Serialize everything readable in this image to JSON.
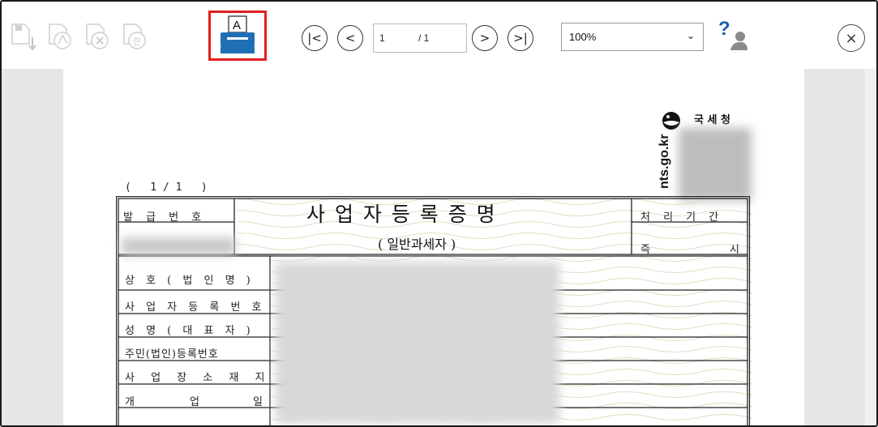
{
  "toolbar": {
    "page_current": "1",
    "page_total": "/ 1",
    "zoom_value": "100%",
    "help_label": "?",
    "first_label": "|<",
    "prev_label": "<",
    "next_label": ">",
    "last_label": ">|",
    "close_label": "×",
    "print_letter": "A"
  },
  "document": {
    "agency_name": "국 세 청",
    "agency_site": "nts.go.kr",
    "page_indicator": "(   1 / 1   )",
    "title": "사 업 자 등 록 증 명",
    "subtitle": "( 일반과세자 )",
    "labels": {
      "issue_no": "발 급 번 호",
      "process_period": "처 리 기 간",
      "immediate_left": "즉",
      "immediate_right": "시",
      "trade_name": "상 호 ( 법 인 명 )",
      "biz_reg_no": "사 업 자 등 록 번 호",
      "name_rep": "성 명 ( 대 표 자 )",
      "resident_no": "주민(법인)등록번호",
      "biz_location": "사 업 장 소 재 지",
      "open_date_left": "개",
      "open_date_mid": "업",
      "open_date_right": "일"
    }
  },
  "colors": {
    "accent_red": "#e0201e",
    "print_blue": "#1f6fb5",
    "help_blue": "#1a5fb4"
  }
}
